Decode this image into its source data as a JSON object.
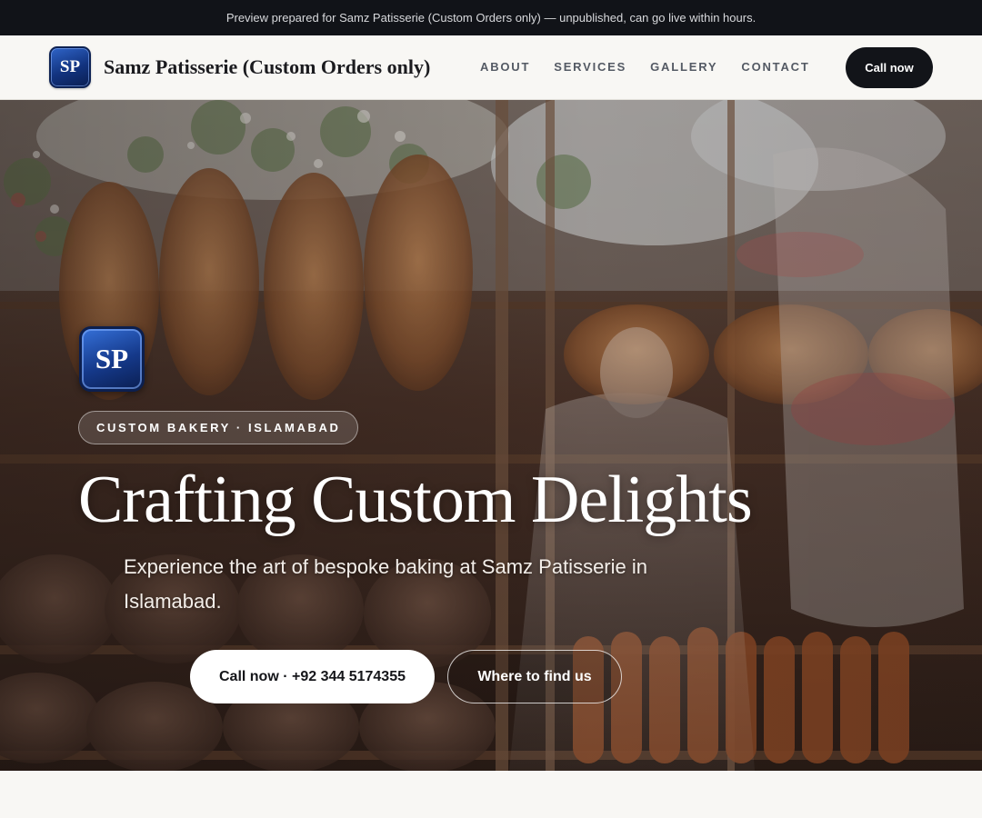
{
  "preview_bar": {
    "text": "Preview prepared for Samz Patisserie (Custom Orders only) — unpublished, can go live within hours."
  },
  "header": {
    "logo_text": "SP",
    "brand": "Samz Patisserie (Custom Orders only)",
    "nav": [
      {
        "label": "ABOUT"
      },
      {
        "label": "SERVICES"
      },
      {
        "label": "GALLERY"
      },
      {
        "label": "CONTACT"
      }
    ],
    "call_button": "Call now"
  },
  "hero": {
    "logo_text": "SP",
    "tagline": "CUSTOM BAKERY · ISLAMABAD",
    "title": "Crafting Custom Delights",
    "subtitle": "Experience the art of bespoke baking at Samz Patisserie in Islamabad.",
    "primary_cta": "Call now · +92 344 5174355",
    "secondary_cta": "Where to find us",
    "background": "bakery-window-photo"
  },
  "colors": {
    "top_bar": "#111318",
    "page_bg": "#f8f7f4",
    "dark_button": "#121419",
    "logo_blue": "#15398a",
    "nav_text": "#545a64"
  }
}
